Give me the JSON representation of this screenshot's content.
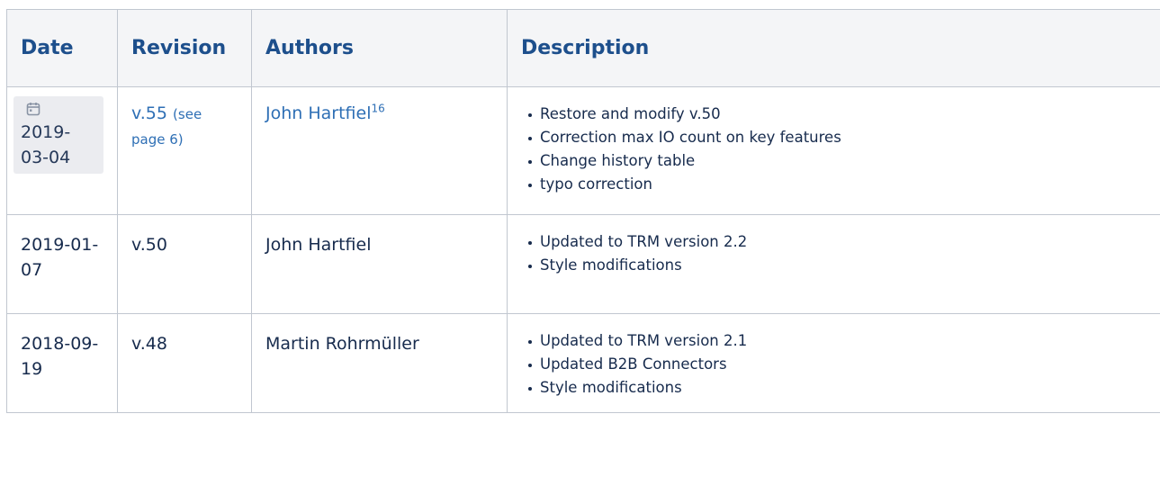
{
  "headers": [
    "Date",
    "Revision",
    "Authors",
    "Description"
  ],
  "rows": [
    {
      "date": "2019-03-04",
      "date_icon": "calendar-icon",
      "revision": "v.55",
      "revision_note": "(see page 6)",
      "author": "John Hartfiel",
      "author_footnote": "16",
      "items": [
        "Restore and modify v.50",
        "Correction max IO count on key features",
        "Change history table",
        "typo correction"
      ]
    },
    {
      "date": "2019-01-07",
      "revision": "v.50",
      "author": "John Hartfiel",
      "items": [
        "Updated to TRM version 2.2",
        "Style modifications"
      ]
    },
    {
      "date": "2018-09-19",
      "revision": "v.48",
      "author": "Martin Rohrmüller",
      "items": [
        "Updated to TRM version 2.1",
        "Updated B2B Connectors",
        "Style modifications"
      ]
    }
  ],
  "colors": {
    "header_bg": "#f4f5f7",
    "header_text": "#1d4f8c",
    "link": "#2e6fb5",
    "border": "#c1c7d0"
  }
}
